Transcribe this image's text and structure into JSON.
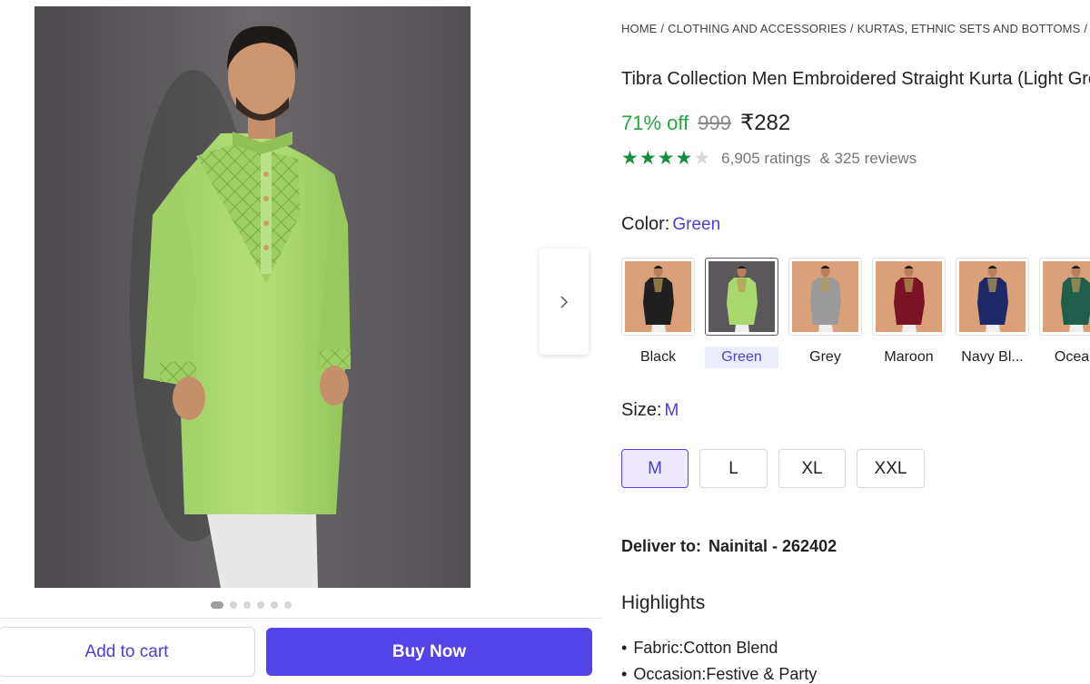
{
  "gallery": {
    "image_count": 6,
    "active_index": 0,
    "add_to_cart_label": "Add to cart",
    "buy_now_label": "Buy Now"
  },
  "breadcrumb": [
    "HOME",
    "CLOTHING AND ACCESSORIES",
    "KURTAS, ETHNIC SETS AND BOTTOMS"
  ],
  "product": {
    "title": "Tibra Collection Men Embroidered Straight Kurta (Light Green)",
    "discount": "71% off",
    "mrp": "999",
    "price": "₹282",
    "rating_stars": 4,
    "ratings_text": "6,905 ratings",
    "reviews_text": "& 325 reviews"
  },
  "color": {
    "label": "Color:",
    "selected": "Green",
    "options": [
      {
        "name": "Black",
        "hex": "#1f1f1f",
        "selected": false
      },
      {
        "name": "Green",
        "hex": "#a9d86e",
        "selected": true
      },
      {
        "name": "Grey",
        "hex": "#9a9a9a",
        "selected": false
      },
      {
        "name": "Maroon",
        "hex": "#7a1425",
        "selected": false
      },
      {
        "name": "Navy Bl...",
        "hex": "#1e2a68",
        "selected": false
      },
      {
        "name": "Ocean",
        "hex": "#1f5e4b",
        "selected": false
      }
    ]
  },
  "size": {
    "label": "Size:",
    "selected": "M",
    "options": [
      "M",
      "L",
      "XL",
      "XXL"
    ]
  },
  "delivery": {
    "label": "Deliver to:",
    "location": "Nainital - 262402"
  },
  "highlights": {
    "title": "Highlights",
    "items": [
      "Fabric:Cotton Blend",
      "Occasion:Festive & Party"
    ]
  },
  "colors": {
    "accent": "#5443e8",
    "discount_green": "#26a541",
    "star_green": "#138f3d"
  }
}
